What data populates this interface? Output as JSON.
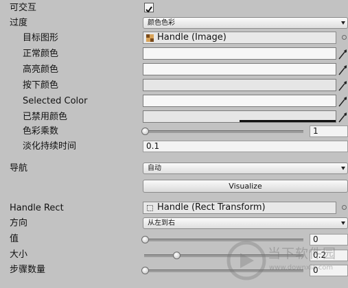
{
  "interactable": {
    "label": "可交互",
    "checked": true
  },
  "transition": {
    "label": "过度",
    "value": "颜色色彩"
  },
  "target_graphic": {
    "label": "目标图形",
    "value": "Handle (Image)"
  },
  "normal_color": {
    "label": "正常颜色"
  },
  "highlighted_color": {
    "label": "高亮颜色"
  },
  "pressed_color": {
    "label": "按下颜色"
  },
  "selected_color": {
    "label": "Selected Color"
  },
  "disabled_color": {
    "label": "已禁用颜色"
  },
  "color_multiplier": {
    "label": "色彩乘数",
    "value": "1",
    "level": 0
  },
  "fade_duration": {
    "label": "淡化持续时间",
    "value": "0.1"
  },
  "navigation": {
    "label": "导航",
    "value": "自动",
    "visualize_label": "Visualize"
  },
  "handle_rect": {
    "label": "Handle Rect",
    "value": "Handle (Rect Transform)"
  },
  "direction": {
    "label": "方向",
    "value": "从左到右"
  },
  "value_field": {
    "label": "值",
    "value": "0",
    "level": 0
  },
  "size_field": {
    "label": "大小",
    "value": "0.2",
    "level": 0.2
  },
  "steps_field": {
    "label": "步骤数量",
    "value": "0",
    "level": 0
  },
  "watermark": {
    "text_cn": "当下软件园",
    "text_url": "www.downxia.com"
  },
  "colors": {
    "panel_bg": "#c2c2c2",
    "field_bg": "#f7f7f7",
    "field_border": "#7a7a7a"
  }
}
